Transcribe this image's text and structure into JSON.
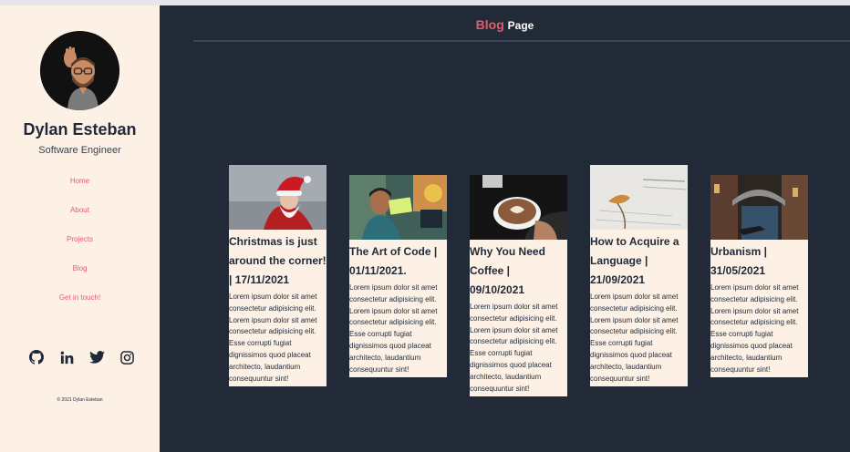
{
  "profile": {
    "name": "Dylan Esteban",
    "role": "Software Engineer"
  },
  "nav": {
    "items": [
      {
        "label": "Home"
      },
      {
        "label": "About"
      },
      {
        "label": "Projects"
      },
      {
        "label": "Blog"
      },
      {
        "label": "Get in touch!"
      }
    ]
  },
  "socials": [
    "github-icon",
    "linkedin-icon",
    "twitter-icon",
    "instagram-icon"
  ],
  "footer": {
    "copyright": "© 2021 Dylan Esteban"
  },
  "header": {
    "title_accent": "Blog",
    "title_rest": "Page"
  },
  "colors": {
    "accent": "#e25c6b",
    "dark": "#222a38",
    "cream": "#fdf1e6"
  },
  "posts": [
    {
      "title": "Christmas is just around the corner! | 17/11/2021",
      "body": "Lorem ipsum dolor sit amet consectetur adipisicing elit. Lorem ipsum dolor sit amet consectetur adipisicing elit. Esse corrupti fugiat dignissimos quod placeat architecto, laudantium consequuntur sint!"
    },
    {
      "title": "The Art of Code | 01/11/2021.",
      "body": "Lorem ipsum dolor sit amet consectetur adipisicing elit. Lorem ipsum dolor sit amet consectetur adipisicing elit. Esse corrupti fugiat dignissimos quod placeat architecto, laudantium consequuntur sint!"
    },
    {
      "title": "Why You Need Coffee | 09/10/2021",
      "body": "Lorem ipsum dolor sit amet consectetur adipisicing elit. Lorem ipsum dolor sit amet consectetur adipisicing elit. Esse corrupti fugiat dignissimos quod placeat architecto, laudantium consequuntur sint!"
    },
    {
      "title": "How to Acquire a Language | 21/09/2021",
      "body": "Lorem ipsum dolor sit amet consectetur adipisicing elit. Lorem ipsum dolor sit amet consectetur adipisicing elit. Esse corrupti fugiat dignissimos quod placeat architecto, laudantium consequuntur sint!"
    },
    {
      "title": "Urbanism | 31/05/2021",
      "body": "Lorem ipsum dolor sit amet consectetur adipisicing elit. Lorem ipsum dolor sit amet consectetur adipisicing elit. Esse corrupti fugiat dignissimos quod placeat architecto, laudantium consequuntur sint!"
    }
  ]
}
